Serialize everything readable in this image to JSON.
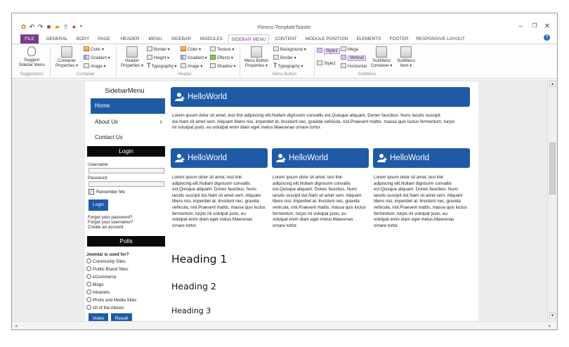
{
  "window": {
    "title": "Fitness-TemplateToaster",
    "minimize": "–",
    "restore": "❐",
    "close": "✕",
    "help": "?"
  },
  "tabs": [
    "FILE",
    "GENERAL",
    "BODY",
    "PAGE",
    "HEADER",
    "MENU",
    "SIDEBAR",
    "MODULES",
    "SIDEBAR MENU",
    "CONTENT",
    "MODULE POSITION",
    "ELEMENTS",
    "FOOTER",
    "RESPONSIVE LAYOUT"
  ],
  "active_tab": "SIDEBAR MENU",
  "ribbon": {
    "suggest": {
      "label1": "Suggest",
      "label2": "Sidebar Menu"
    },
    "container_props": {
      "label1": "Container",
      "label2": "Properties ▾"
    },
    "color": "Color ▾",
    "gradient": "Gradient ▾",
    "image": "Image ▾",
    "header_props": {
      "label1": "Header",
      "label2": "Properties ▾"
    },
    "border": "Border ▾",
    "height": "Height ▾",
    "typography": "Typography ▾",
    "h_color": "Color ▾",
    "h_gradient": "Gradient ▾",
    "h_image": "Image ▾",
    "texture": "Texture ▾",
    "effects": "Effects ▾",
    "shadow": "Shadow ▾",
    "menu_button_props": {
      "label1": "Menu Button",
      "label2": "Properties ▾"
    },
    "background": "Background ▾",
    "mb_border": "Border ▾",
    "mb_typography": "Typography ▾",
    "style1": "Style1",
    "style2": "Style2",
    "mega": "Mega",
    "vertical": "Vertical",
    "horizontal": "Horizontal",
    "submenu_container": {
      "label1": "SubMenu",
      "label2": "Container ▾"
    },
    "submenu_item": {
      "label1": "SubMenu",
      "label2": "Item ▾"
    },
    "groups": {
      "suggestions": "Suggestions",
      "container": "Container",
      "header": "Header",
      "menu_button": "Menu Button",
      "submenu": "SubMenu"
    }
  },
  "sidebar": {
    "title": "SidebarMenu",
    "items": [
      {
        "label": "Home"
      },
      {
        "label": "About Us",
        "arrow": "›"
      },
      {
        "label": "Contact Us"
      }
    ],
    "login": {
      "title": "Login",
      "username_label": "Username",
      "password_label": "Password",
      "remember": "Remember Me",
      "checkmark": "✓",
      "button": "Login",
      "forgot_password": "Forgot your password?",
      "forgot_username": "Forgot your username?",
      "create": "Create an account"
    },
    "polls": {
      "title": "Polls",
      "question": "Joomla! is used for?",
      "options": [
        "Community Sites",
        "Public Brand Sites",
        "eCommerce",
        "Blogs",
        "Intranets",
        "Photo and Media Sites",
        "All of the Above!"
      ],
      "vote": "Votes",
      "result": "Result"
    }
  },
  "content": {
    "box_title": "HelloWorld",
    "wide_text_1": "Lorem ipsum dolor sit amet, test link adipiscing elit.Nullam dignissim convallis est.Quisque aliquam. Donec faucibus. Nunc iaculis suscipit",
    "wide_text_2": "dui.Nam sit amet sem. Aliquam libero nisi, imperdiet at, tincidunt nec, gravida vehicula, nisl.Praesent mattis, massa quis luctus fermentum, turpis",
    "wide_text_3": "mi volutpat justo, eu volutpat enim diam eget metus.Maecenas ornare tortor.",
    "col_lines": [
      "Lorem ipsum dolor sit amet, test link",
      "adipiscing elit.Nullam dignissim convallis",
      "est.Quisque aliquam. Donec faucibus. Nunc",
      "iaculis suscipit dui.Nam sit amet sem. Aliquam",
      "libero nisi, imperdiet at, tincidunt nec, gravida",
      "vehicula, nisl.Praesent mattis, massa quis luctus",
      "fermentum, turpis mi volutpat justo, eu",
      "volutpat enim diam eget metus.Maecenas",
      "ornare tortor."
    ],
    "heading1": "Heading  1",
    "heading2": "Heading  2",
    "heading3": "Heading  3"
  },
  "scroll": {
    "up": "▲",
    "down": "▼",
    "left": "◂",
    "right": "▸"
  }
}
